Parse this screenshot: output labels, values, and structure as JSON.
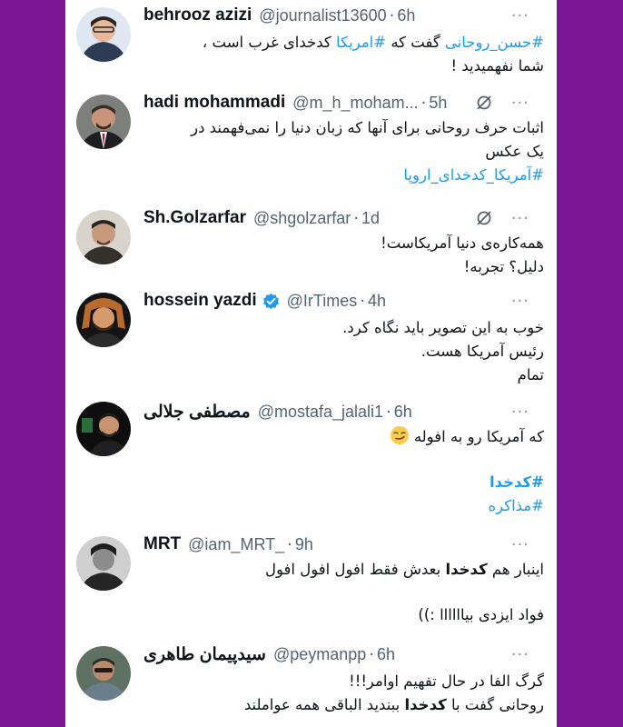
{
  "tweets": [
    {
      "name": "behrooz azizi",
      "handle": "@journalist13600",
      "dot": "·",
      "time": "6h",
      "more": "···",
      "line1_tag1": "#حسن_روحانی",
      "line1_mid": " گفت که ",
      "line1_tag2": "#امریکا",
      "line1_end": " کدخدای غرب است ،",
      "line2": "شما نفهمیدید !"
    },
    {
      "name": "hadi mohammadi",
      "handle": "@m_h_moham...",
      "dot": "·",
      "time": "5h",
      "more": "···",
      "line1": "اثبات حرف روحانی برای آنها که زبان دنیا را نمی‌فهمند در",
      "line2": "یک عکس",
      "line3_tag": "#آمریکا_کدخدای_اروپا"
    },
    {
      "name": "Sh.Golzarfar",
      "handle": "@shgolzarfar",
      "dot": "·",
      "time": "1d",
      "more": "···",
      "line1": "همه‌کاره‌ی دنیا آمریکاست!",
      "line2": "دلیل؟ تجربه!"
    },
    {
      "name": "hossein yazdi",
      "handle": "@IrTimes",
      "dot": "·",
      "time": "4h",
      "more": "···",
      "line1": "خوب به این تصویر باید نگاه کرد.",
      "line2": "رئیس آمریکا هست.",
      "line3": "تمام"
    },
    {
      "name": "مصطفی جلالی",
      "handle": "@mostafa_jalali1",
      "dot": "·",
      "time": "6h",
      "more": "···",
      "line1": "که آمریکا رو به افوله",
      "emoji": "smirk",
      "tag1": "#کدخدا",
      "tag2": "#مذاکره"
    },
    {
      "name": "MRT",
      "handle": "@iam_MRT_",
      "dot": "·",
      "time": "9h",
      "more": "···",
      "line1_a": "اینبار هم ",
      "line1_bold": "کدخدا",
      "line1_b": " بعدش فقط افول افول افول",
      "line2": "فواد ایزدی بیاااااا :))"
    },
    {
      "name": "سیدپیمان طاهری",
      "handle": "@peymanpp",
      "dot": "·",
      "time": "6h",
      "more": "···",
      "line1": "گرگ الفا در حال تفهیم اوامر!!!",
      "line2_a": "روحانی گفت با ",
      "line2_bold": "کدخدا",
      "line2_b": " ببندید الباقی همه عواملند"
    }
  ],
  "colors": {
    "frame": "#7b1591",
    "hashtag": "#1d9bf0",
    "verified": "#1d9bf0",
    "secondary_text": "#536471"
  },
  "icons": {
    "grok": "grok-slash-circle-icon",
    "more": "more-dots-icon",
    "verified": "verified-badge-icon",
    "emoji": "smirking-face-emoji"
  }
}
